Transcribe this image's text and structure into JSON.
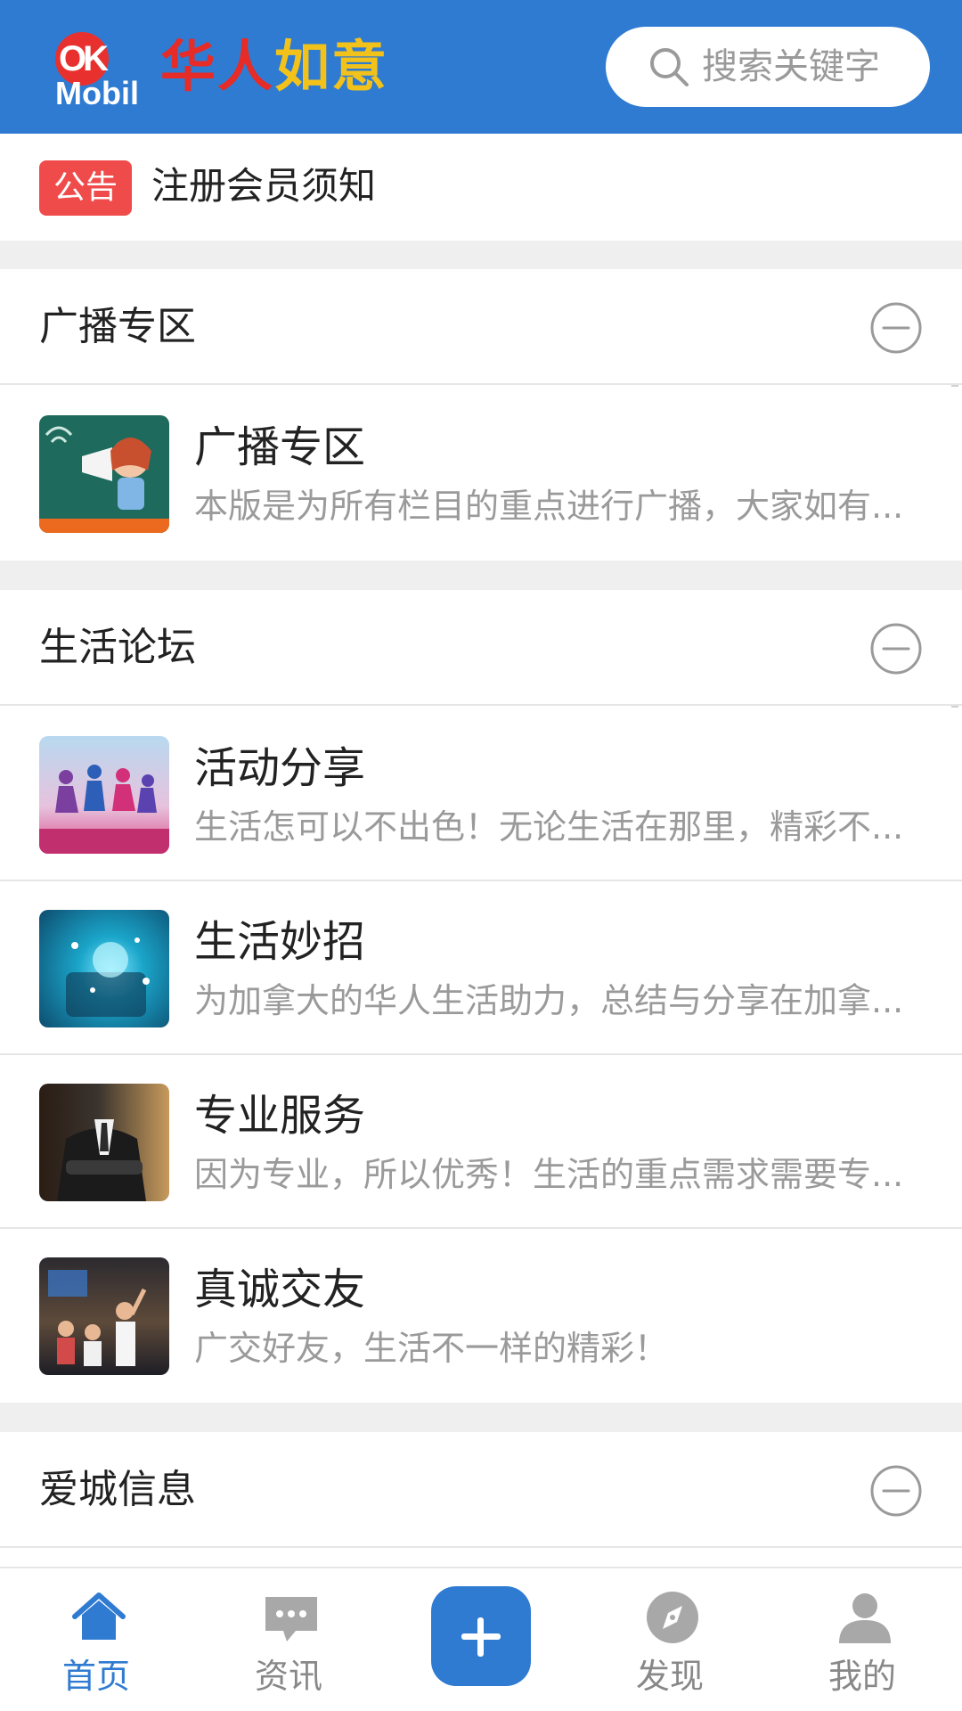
{
  "header": {
    "logo_badge": "OK",
    "logo_sub": "Mobil",
    "title_red": "华人",
    "title_yellow": "如意",
    "search_placeholder": "搜索关键字"
  },
  "notice": {
    "badge": "公告",
    "text": "注册会员须知"
  },
  "sections": [
    {
      "title": "广播专区",
      "items": [
        {
          "title": "广播专区",
          "desc": "本版是为所有栏目的重点进行广播，大家如有..."
        }
      ]
    },
    {
      "title": "生活论坛",
      "items": [
        {
          "title": "活动分享",
          "desc": "生活怎可以不出色！无论生活在那里，精彩不..."
        },
        {
          "title": "生活妙招",
          "desc": "为加拿大的华人生活助力，总结与分享在加拿..."
        },
        {
          "title": "专业服务",
          "desc": "因为专业，所以优秀！生活的重点需求需要专..."
        },
        {
          "title": "真诚交友",
          "desc": "广交好友，生活不一样的精彩！"
        }
      ]
    },
    {
      "title": "爱城信息",
      "items": []
    }
  ],
  "bottom_nav": {
    "items": [
      {
        "label": "首页",
        "icon": "home-icon",
        "active": true
      },
      {
        "label": "资讯",
        "icon": "chat-icon",
        "active": false
      },
      {
        "label": "",
        "icon": "plus-icon",
        "active": false
      },
      {
        "label": "发现",
        "icon": "compass-icon",
        "active": false
      },
      {
        "label": "我的",
        "icon": "user-icon",
        "active": false
      }
    ]
  },
  "colors": {
    "primary": "#2f7bd2",
    "notice_badge": "#f04b4b",
    "logo_red": "#e72b26",
    "logo_yellow": "#f2c21b",
    "muted_text": "#9a9a9a",
    "divider": "#efefef"
  }
}
